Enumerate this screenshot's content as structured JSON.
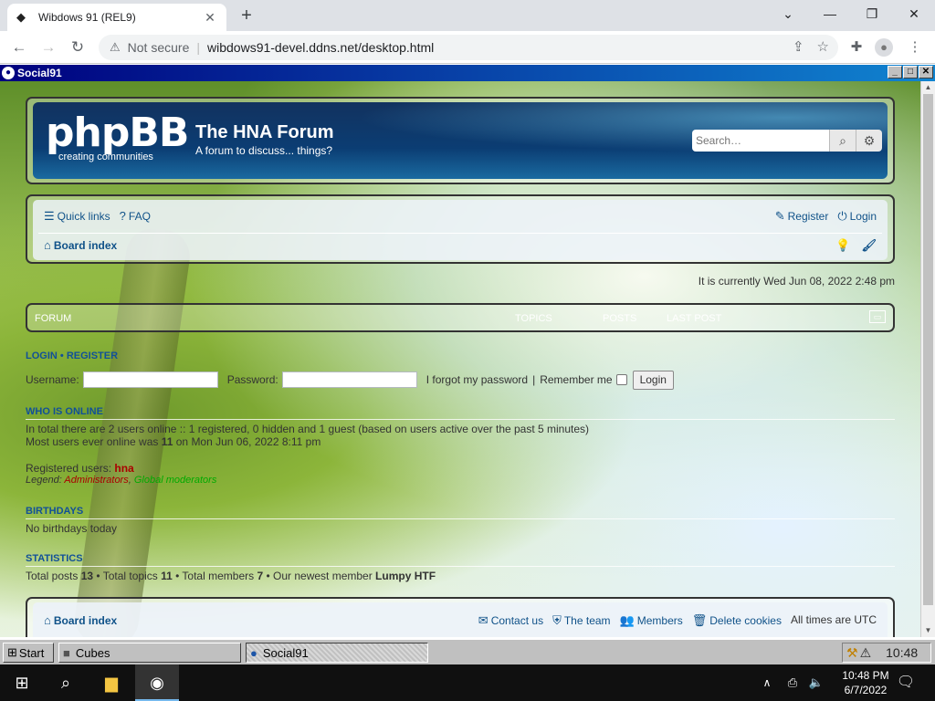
{
  "browser": {
    "tab_title": "Wibdows 91 (REL9)",
    "tab_close": "✕",
    "new_tab": "+",
    "not_secure": "Not secure",
    "url": "wibdows91-devel.ddns.net/desktop.html"
  },
  "window": {
    "title": "Social91"
  },
  "forum": {
    "site_title": "The HNA Forum",
    "site_desc": "A forum to discuss... things?",
    "logo_text": "phpBB",
    "logo_tag": "creating  communities",
    "search_placeholder": "Search…",
    "nav": {
      "quick_links": "Quick links",
      "faq": "FAQ",
      "register": "Register",
      "login": "Login",
      "board_index": "Board index"
    },
    "current_time": "It is currently Wed Jun 08, 2022 2:48 pm",
    "table_head": {
      "forum": "Forum",
      "topics": "Topics",
      "posts": "Posts",
      "last_post": "Last post"
    },
    "login_section": {
      "heading_login": "Login",
      "heading_sep": "•",
      "heading_register": "Register",
      "username_label": "Username:",
      "password_label": "Password:",
      "forgot": "I forgot my password",
      "sep": "|",
      "remember": "Remember me",
      "login_button": "Login"
    },
    "who_is_online": {
      "heading": "Who is online",
      "line1": "In total there are 2 users online :: 1 registered, 0 hidden and 1 guest (based on users active over the past 5 minutes)",
      "line2_pre": "Most users ever online was ",
      "line2_num": "11",
      "line2_post": " on Mon Jun 06, 2022 8:11 pm",
      "registered_label": "Registered users: ",
      "registered_user": "hna",
      "legend_label": "Legend: ",
      "legend_admin": "Administrators",
      "legend_sep": ", ",
      "legend_mod": "Global moderators"
    },
    "birthdays": {
      "heading": "Birthdays",
      "text": "No birthdays today"
    },
    "statistics": {
      "heading": "Statistics",
      "total_posts_label": "Total posts ",
      "total_posts": "13",
      "total_topics_label": " • Total topics ",
      "total_topics": "11",
      "total_members_label": " • Total members ",
      "total_members": "7",
      "newest_label": " • Our newest member ",
      "newest": "Lumpy HTF"
    },
    "footer": {
      "board_index": "Board index",
      "contact": "Contact us",
      "team": "The team",
      "members": "Members",
      "delete_cookies": "Delete cookies",
      "timezone": "All times are UTC"
    }
  },
  "w95taskbar": {
    "start": "Start",
    "task1": "Cubes",
    "task2": "Social91",
    "clock": "10:48"
  },
  "w10taskbar": {
    "time": "10:48 PM",
    "date": "6/7/2022"
  }
}
